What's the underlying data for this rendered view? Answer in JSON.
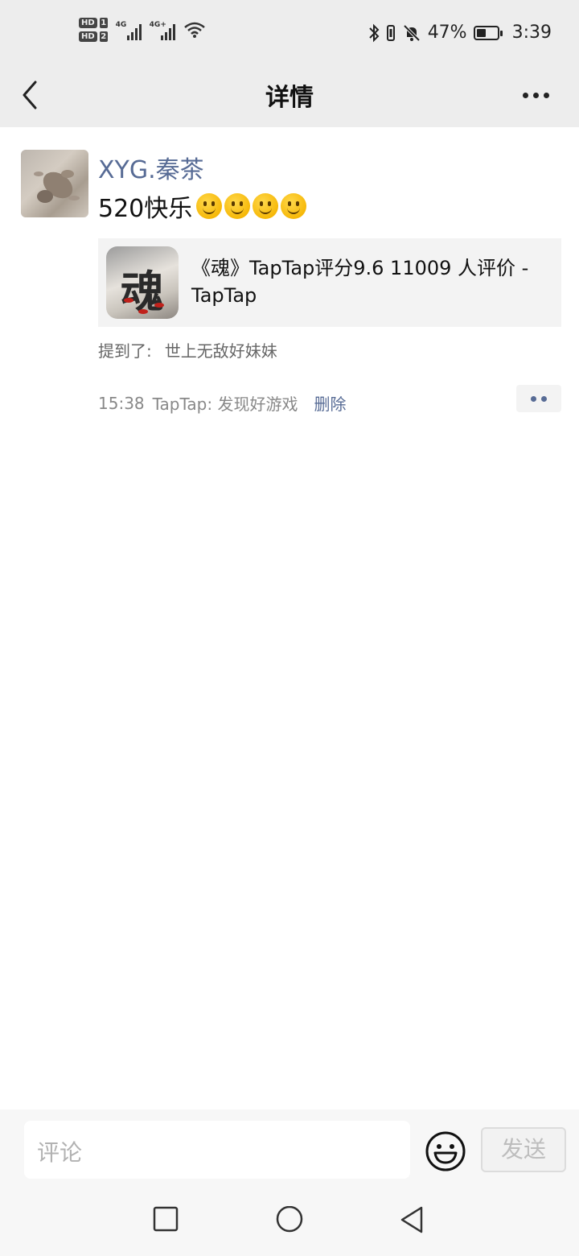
{
  "status_bar": {
    "sim1": "HD",
    "sim1_num": "1",
    "sim2": "HD",
    "sim2_num": "2",
    "net1": "4G",
    "net2": "4G+",
    "battery_pct": "47%",
    "battery_level": 0.47,
    "time": "3:39"
  },
  "nav": {
    "title": "详情"
  },
  "post": {
    "username": "XYG.秦茶",
    "text": "520快乐",
    "emoji_count": 4,
    "link_card": {
      "title": "《魂》TapTap评分9.6 11009 人评价 - TapTap",
      "thumb_glyph": "魂"
    },
    "mention_label": "提到了:",
    "mention_user": "世上无敌好妹妹",
    "time": "15:38",
    "source": "TapTap: 发现好游戏",
    "delete_label": "删除"
  },
  "comment_bar": {
    "placeholder": "评论",
    "send_label": "发送"
  },
  "colors": {
    "link_blue": "#576b95",
    "header_bg": "#ededed"
  }
}
